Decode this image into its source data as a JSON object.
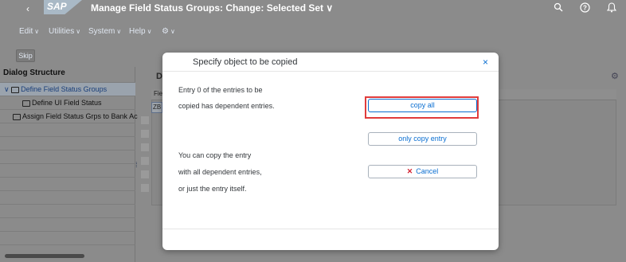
{
  "shell": {
    "logo": "SAP",
    "title": "Manage Field Status Groups: Change: Selected Set",
    "title_chevron": "∨",
    "back_icon": "‹",
    "search_icon": "⌕",
    "help_icon": "?",
    "bell_icon": "🔔"
  },
  "menu": {
    "items": [
      "Edit",
      "Utilities",
      "System",
      "Help"
    ],
    "chevron": "∨",
    "settings_icon": "⚙"
  },
  "toolbar": {
    "skip_label": "Skip"
  },
  "tree": {
    "header": "Dialog Structure",
    "nodes": [
      "Define Field Status Groups",
      "Define UI Field Status",
      "Assign Field Status Grps to Bank Ac"
    ],
    "expand_icon": "∨"
  },
  "right_pane": {
    "heading": "De",
    "column_header": "Fie",
    "cell_value": "ZB",
    "settings_icon": "⚙"
  },
  "dialog": {
    "title": "Specify object to be copied",
    "close_icon": "×",
    "line1": "Entry  0  of the entries to be",
    "line2": "copied has dependent entries.",
    "line3": "You can copy the entry",
    "line4": "with all dependent entries,",
    "line5": "or just the entry itself.",
    "copy_all_label": "copy all",
    "only_copy_label": "only copy entry",
    "cancel_label": "Cancel",
    "cancel_icon": "✕"
  },
  "colors": {
    "accent": "#0a6ed1",
    "highlight": "#e03c3c",
    "overlay": "#8b8b8b"
  }
}
